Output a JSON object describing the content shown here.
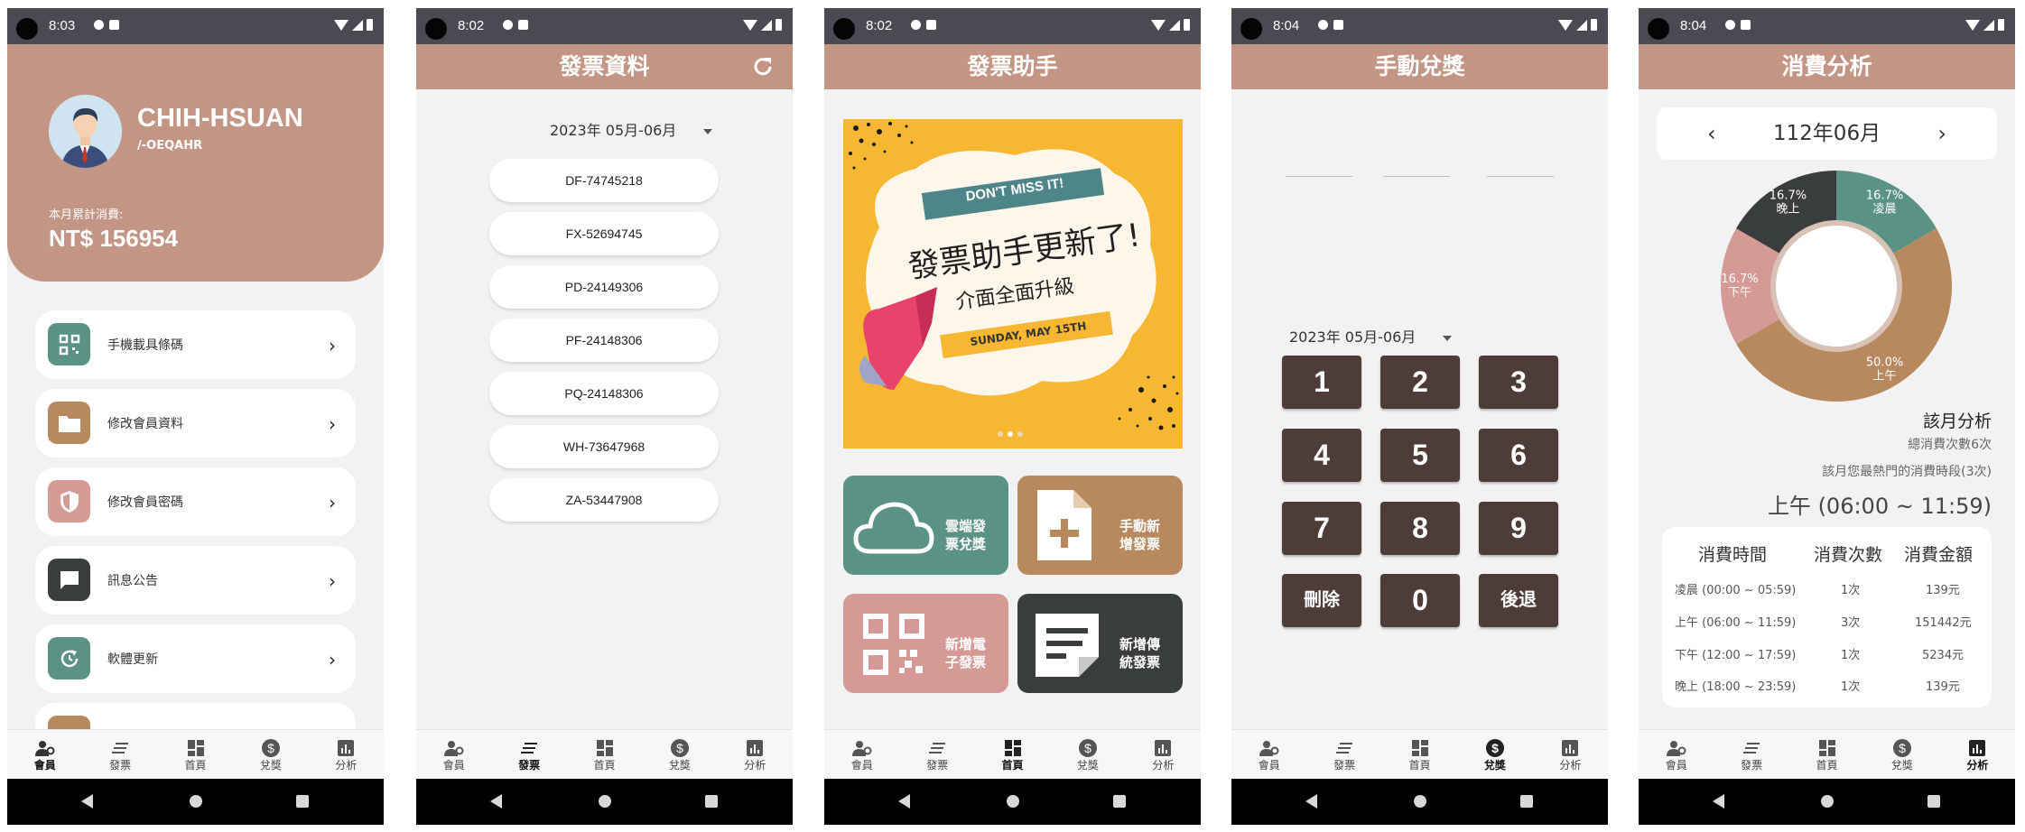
{
  "status": {
    "times": [
      "8:03",
      "8:02",
      "8:02",
      "8:04",
      "8:04"
    ]
  },
  "nav": [
    "會員",
    "發票",
    "首頁",
    "兌獎",
    "分析"
  ],
  "member": {
    "name": "CHIH-HSUAN",
    "code": "/-OEQAHR",
    "consumption_label": "本月累計消費:",
    "consumption_value": "NT$ 156954",
    "menu": [
      {
        "label": "手機載具條碼",
        "icon": "qr-code-icon",
        "color": "#5a9283"
      },
      {
        "label": "修改會員資料",
        "icon": "folder-icon",
        "color": "#b8895f"
      },
      {
        "label": "修改會員密碼",
        "icon": "shield-icon",
        "color": "#d59a96"
      },
      {
        "label": "訊息公告",
        "icon": "chat-icon",
        "color": "#3a3d3e"
      },
      {
        "label": "軟體更新",
        "icon": "update-icon",
        "color": "#5a9283"
      }
    ]
  },
  "invoice": {
    "title": "發票資料",
    "date": "2023年 05月-06月",
    "items": [
      "DF-74745218",
      "FX-52694745",
      "PD-24149306",
      "PF-24148306",
      "PQ-24148306",
      "WH-73647968",
      "ZA-53447908"
    ]
  },
  "assistant": {
    "title": "發票助手",
    "banner": {
      "badge": "DON'T MISS IT!",
      "headline": "發票助手更新了!",
      "subline": "介面全面升級",
      "date": "SUNDAY, MAY 15TH"
    },
    "tiles": [
      {
        "label": "雲端發票兌獎",
        "icon": "cloud-icon",
        "color": "#5a9283"
      },
      {
        "label": "手動新增發票",
        "icon": "add-file-icon",
        "color": "#b8895f"
      },
      {
        "label": "新增電子發票",
        "icon": "qr-code-icon",
        "color": "#d59a96"
      },
      {
        "label": "新增傳統發票",
        "icon": "note-icon",
        "color": "#3a3d3e"
      }
    ]
  },
  "lottery": {
    "title": "手動兌獎",
    "date": "2023年 05月-06月",
    "keys": [
      "1",
      "2",
      "3",
      "4",
      "5",
      "6",
      "7",
      "8",
      "9",
      "刪除",
      "0",
      "後退"
    ]
  },
  "analysis": {
    "title": "消費分析",
    "month": "112年06月",
    "summary_title": "該月分析",
    "total_count": "總消費次數6次",
    "hot_label": "該月您最熱門的消費時段(3次)",
    "hot_value": "上午 (06:00 ~ 11:59)",
    "table_headers": [
      "消費時間",
      "消費次數",
      "消費金額"
    ],
    "rows": [
      {
        "time": "凌晨 (00:00 ~ 05:59)",
        "count": "1次",
        "amount": "139元"
      },
      {
        "time": "上午 (06:00 ~ 11:59)",
        "count": "3次",
        "amount": "151442元"
      },
      {
        "time": "下午 (12:00 ~ 17:59)",
        "count": "1次",
        "amount": "5234元"
      },
      {
        "time": "晚上 (18:00 ~ 23:59)",
        "count": "1次",
        "amount": "139元"
      }
    ]
  },
  "chart_data": {
    "type": "pie",
    "categories": [
      "凌晨",
      "上午",
      "下午",
      "晚上"
    ],
    "values": [
      16.7,
      50.0,
      16.7,
      16.7
    ],
    "labels": [
      "16.7%",
      "50.0%",
      "16.7%",
      "16.7%"
    ],
    "colors": [
      "#5a9283",
      "#b8895f",
      "#d59a96",
      "#3a3d3e"
    ]
  }
}
